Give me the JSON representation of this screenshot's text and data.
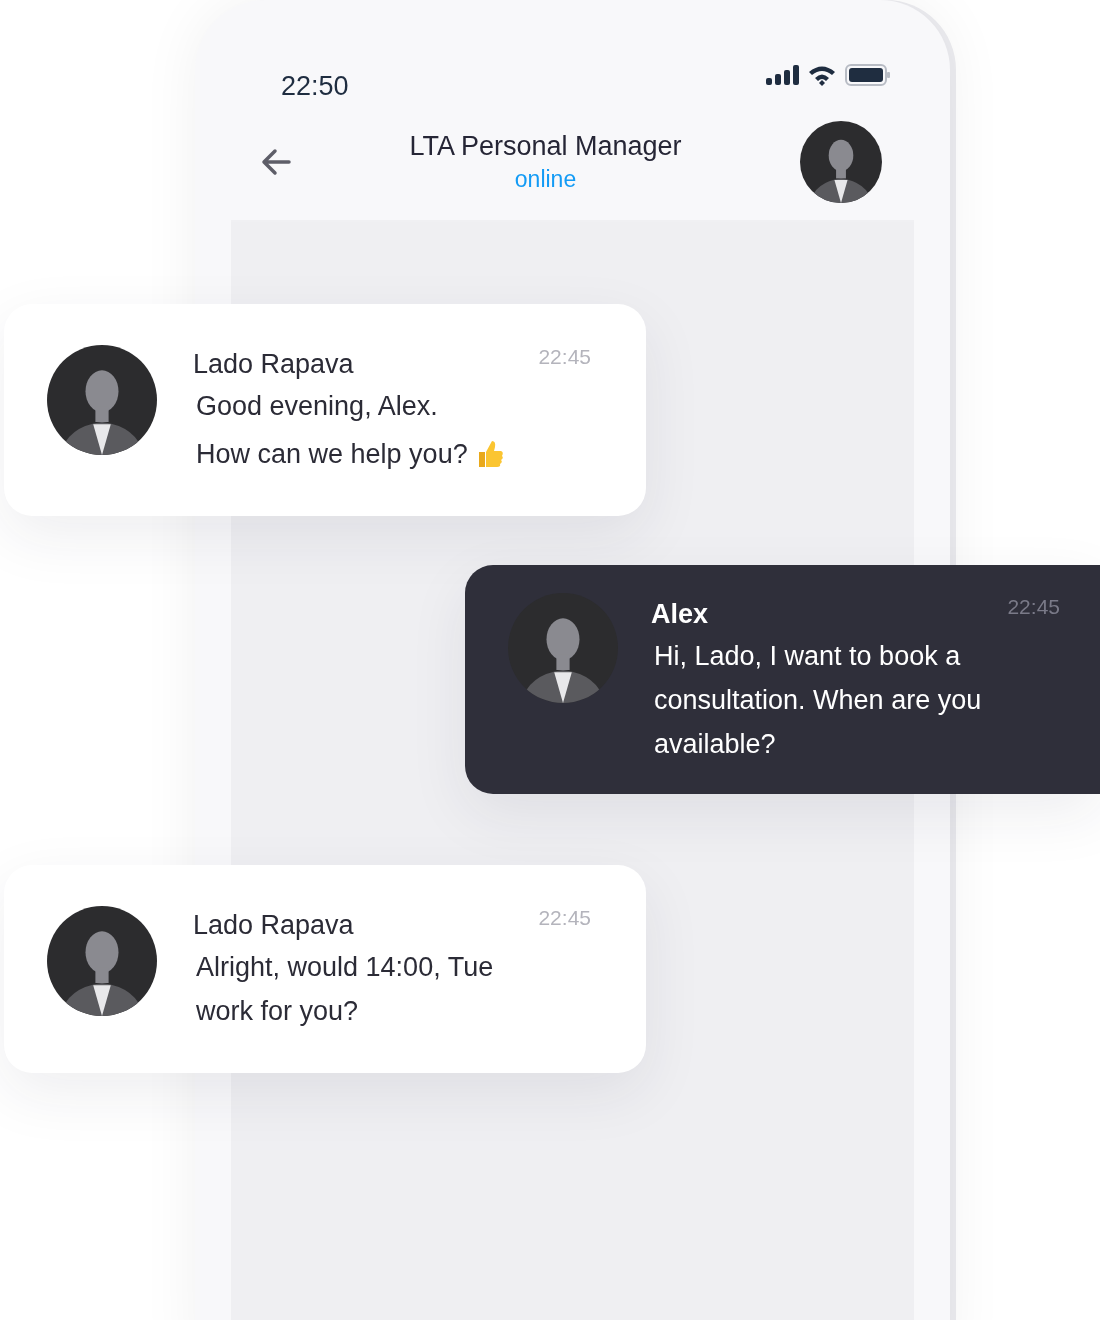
{
  "status_bar": {
    "time": "22:50"
  },
  "header": {
    "title": "LTA Personal Manager",
    "status": "online"
  },
  "messages": [
    {
      "kind": "incoming",
      "sender": "Lado Rapava",
      "time": "22:45",
      "lines": [
        "Good evening, Alex.",
        "How can we help you?"
      ],
      "thumbs_up": true
    },
    {
      "kind": "outgoing",
      "sender": "Alex",
      "time": "22:45",
      "lines": [
        "Hi, Lado, I want to book a consultation. When are you available?"
      ]
    },
    {
      "kind": "incoming",
      "sender": "Lado Rapava",
      "time": "22:45",
      "lines": [
        "Alright, would 14:00, Tue work for you?"
      ]
    }
  ]
}
